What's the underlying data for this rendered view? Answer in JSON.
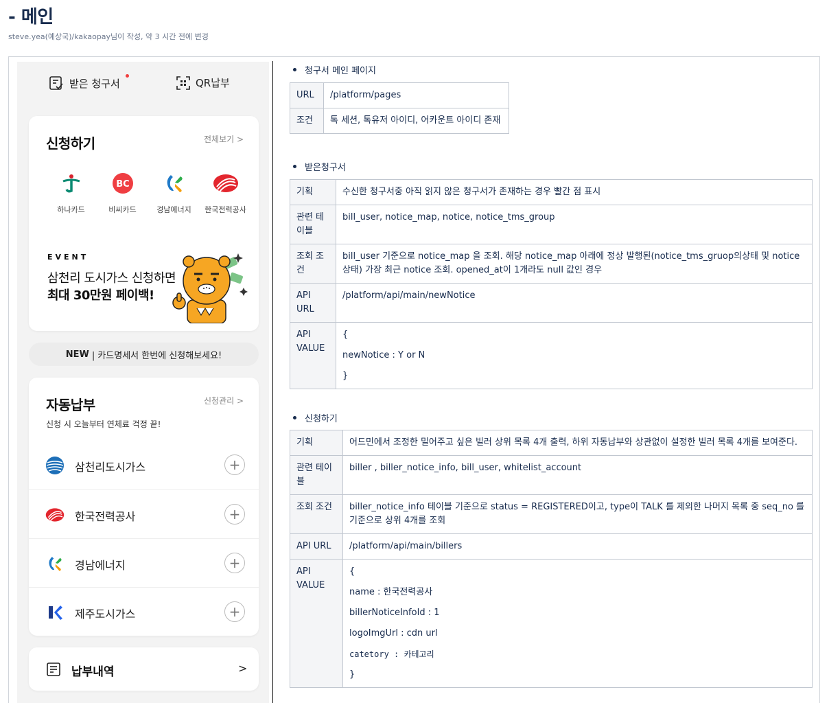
{
  "page": {
    "title": "- 메인",
    "meta": "steve.yea(예상국)/kakaopay님이 작성, 약 3 시간 전에 변경"
  },
  "app": {
    "top_tabs": [
      {
        "label": "받은 청구서",
        "icon": "bill-check-icon",
        "has_dot": true
      },
      {
        "label": "QR납부",
        "icon": "qr-scan-icon"
      }
    ],
    "apply": {
      "title": "신청하기",
      "link": "전체보기 >",
      "billers": [
        {
          "name": "하나카드",
          "icon": "hana-card-logo"
        },
        {
          "name": "비씨카드",
          "icon": "bc-card-logo"
        },
        {
          "name": "경남에너지",
          "icon": "gyeongnam-energy-logo"
        },
        {
          "name": "한국전력공사",
          "icon": "kepco-logo"
        }
      ],
      "event_tag": "EVENT",
      "event_line1": "삼천리 도시가스 신청하면",
      "event_line2": "최대 30만원 페이백!"
    },
    "new_banner": {
      "badge": "NEW",
      "text": "| 카드명세서 한번에 신청해보세요!"
    },
    "auto": {
      "title": "자동납부",
      "link": "신청관리 >",
      "subtitle": "신청 시 오늘부터 연체료 걱정 끝!",
      "items": [
        {
          "name": "삼천리도시가스",
          "icon": "samchully-logo"
        },
        {
          "name": "한국전력공사",
          "icon": "kepco-logo"
        },
        {
          "name": "경남에너지",
          "icon": "gyeongnam-energy-logo"
        },
        {
          "name": "제주도시가스",
          "icon": "jeju-gas-logo"
        }
      ],
      "plus": "+"
    },
    "history": {
      "label": "납부내역",
      "chevron": ">",
      "icon": "receipt-icon"
    }
  },
  "doc": {
    "sec1": {
      "title": "청구서 메인 페이지",
      "rows": [
        {
          "k": "URL",
          "v": "/platform/pages"
        },
        {
          "k": "조건",
          "v": "톡 세션, 톡유저 아이디, 어카운트 아이디 존재"
        }
      ]
    },
    "sec2": {
      "title": "받은청구서",
      "rows": [
        {
          "k": "기획",
          "v": "수신한 청구서중 아직 읽지 않은 청구서가 존재하는 경우 빨간 점 표시"
        },
        {
          "k": "관련 테이블",
          "v": "bill_user, notice_map, notice, notice_tms_group"
        },
        {
          "k": "조회 조건",
          "v": "bill_user 기준으로 notice_map 을 조회. 해당 notice_map 아래에 정상 발행된(notice_tms_gruop의상태 및 notice 상태) 가장 최근 notice 조회. opened_at이 1개라도 null 값인 경우"
        },
        {
          "k": "API URL",
          "v": "/platform/api/main/newNotice"
        },
        {
          "k": "API VALUE",
          "lines": [
            "{",
            "newNotice : Y or N",
            "}"
          ]
        }
      ]
    },
    "sec3": {
      "title": "신청하기",
      "rows": [
        {
          "k": "기획",
          "v": "어드민에서 조정한 밀어주고 싶은 빌러 상위 목록 4개 출력, 하위 자동납부와 상관없이 설정한 빌러 목록 4개를 보여준다."
        },
        {
          "k": "관련 테이블",
          "v": "biller , biller_notice_info, bill_user, whitelist_account"
        },
        {
          "k": "조회 조건",
          "v": "biller_notice_info 테이블 기준으로 status = REGISTERED이고, type이 TALK 를 제외한 나머지 목록 중 seq_no 를 기준으로 상위 4개를 조회"
        },
        {
          "k": "API URL",
          "v": "/platform/api/main/billers"
        },
        {
          "k": "API VALUE",
          "lines": [
            "{",
            "name : 한국전력공사",
            "billerNoticeInfoId : 1",
            "logoImgUrl : cdn url",
            "catetory : 카테고리",
            "}"
          ]
        }
      ]
    }
  }
}
